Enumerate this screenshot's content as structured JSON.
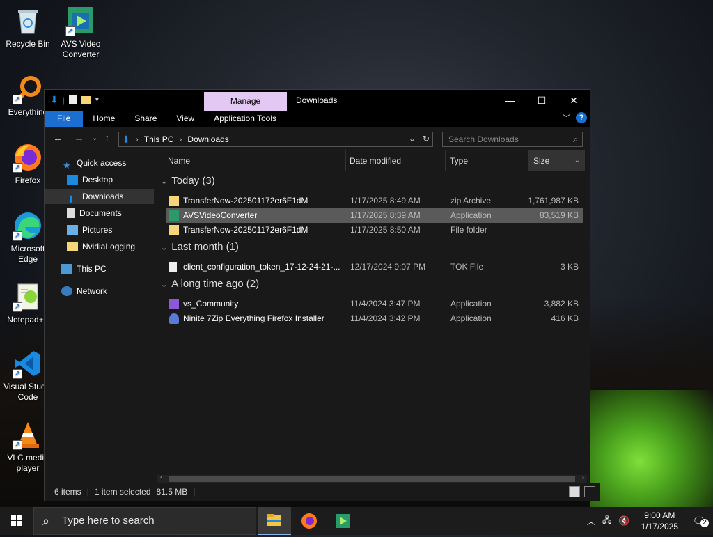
{
  "desktop": {
    "icons": [
      {
        "label": "Recycle Bin"
      },
      {
        "label": "AVS Video Converter"
      },
      {
        "label": "Everything"
      },
      {
        "label": "Firefox"
      },
      {
        "label": "Microsoft Edge"
      },
      {
        "label": "Notepad++"
      },
      {
        "label": "Visual Studio Code"
      },
      {
        "label": "VLC media player"
      }
    ]
  },
  "explorer": {
    "title": "Downloads",
    "contextual_tab": "Manage",
    "ribbon_tabs": [
      "File",
      "Home",
      "Share",
      "View",
      "Application Tools"
    ],
    "breadcrumb": [
      "This PC",
      "Downloads"
    ],
    "search_placeholder": "Search Downloads",
    "nav": {
      "quick_access": "Quick access",
      "items": [
        "Desktop",
        "Downloads",
        "Documents",
        "Pictures",
        "NvidiaLogging"
      ],
      "this_pc": "This PC",
      "network": "Network"
    },
    "columns": {
      "name": "Name",
      "date": "Date modified",
      "type": "Type",
      "size": "Size"
    },
    "groups": [
      {
        "label": "Today (3)",
        "rows": [
          {
            "name": "TransferNow-202501172er6F1dM",
            "date": "1/17/2025 8:49 AM",
            "type": "zip Archive",
            "size": "1,761,987 KB"
          },
          {
            "name": "AVSVideoConverter",
            "date": "1/17/2025 8:39 AM",
            "type": "Application",
            "size": "83,519 KB"
          },
          {
            "name": "TransferNow-202501172er6F1dM",
            "date": "1/17/2025 8:50 AM",
            "type": "File folder",
            "size": ""
          }
        ]
      },
      {
        "label": "Last month (1)",
        "rows": [
          {
            "name": "client_configuration_token_17-12-24-21-...",
            "date": "12/17/2024 9:07 PM",
            "type": "TOK File",
            "size": "3 KB"
          }
        ]
      },
      {
        "label": "A long time ago (2)",
        "rows": [
          {
            "name": "vs_Community",
            "date": "11/4/2024 3:47 PM",
            "type": "Application",
            "size": "3,882 KB"
          },
          {
            "name": "Ninite 7Zip Everything Firefox Installer",
            "date": "11/4/2024 3:42 PM",
            "type": "Application",
            "size": "416 KB"
          }
        ]
      }
    ],
    "status": {
      "items": "6 items",
      "selected": "1 item selected",
      "size": "81.5 MB"
    }
  },
  "taskbar": {
    "search_placeholder": "Type here to search",
    "time": "9:00 AM",
    "date": "1/17/2025",
    "notifications": "2"
  }
}
